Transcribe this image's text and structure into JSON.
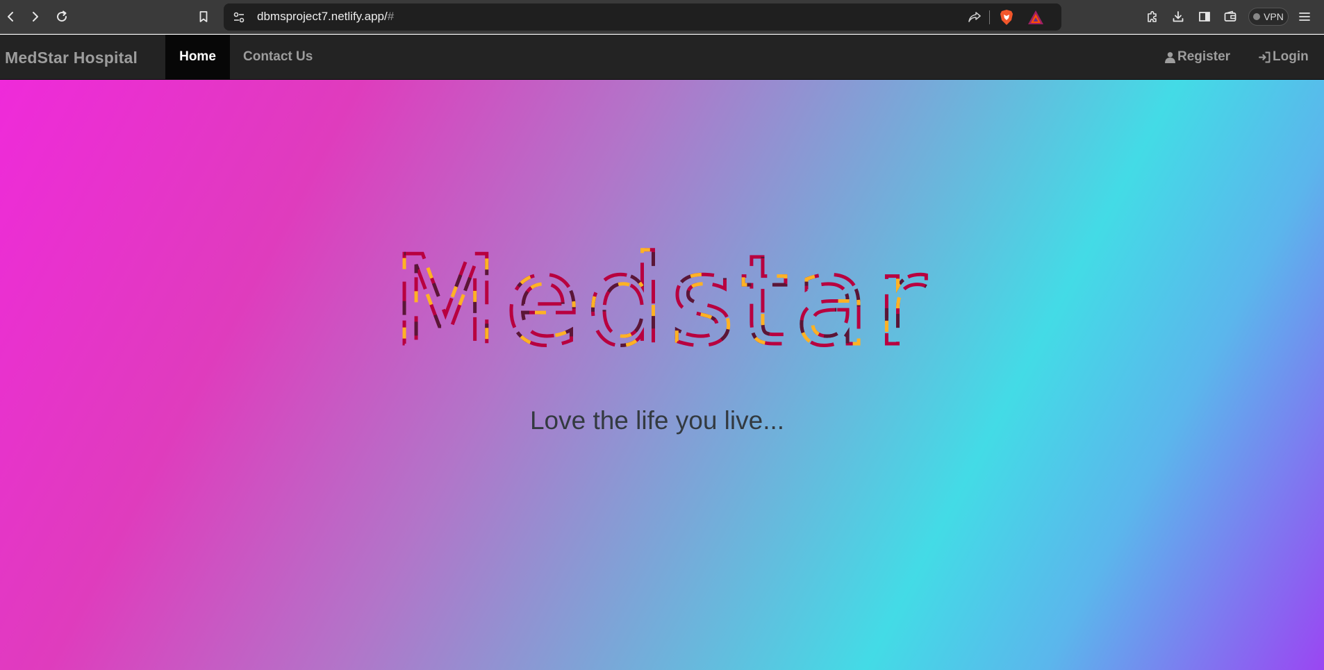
{
  "browser": {
    "url": "dbmsproject7.netlify.app/",
    "url_hash": "#",
    "vpn_label": "VPN",
    "icons": [
      "back-icon",
      "forward-icon",
      "reload-icon",
      "bookmark-icon",
      "site-settings-icon",
      "share-icon",
      "brave-shields-icon",
      "brave-rewards-icon",
      "extensions-icon",
      "downloads-icon",
      "sidebar-icon",
      "wallet-icon",
      "menu-icon"
    ]
  },
  "navbar": {
    "brand": "MedStar Hospital",
    "links": {
      "home": "Home",
      "contact": "Contact Us",
      "register": "Register",
      "login": "Login"
    },
    "icons": [
      "user-icon",
      "login-icon"
    ]
  },
  "hero": {
    "title": "Medstar",
    "tagline": "Love the life you live...",
    "gradient_colors": [
      "#ef2ada",
      "#df3cbd",
      "#b275c9",
      "#7aa7d8",
      "#43dbe6",
      "#7e79f0",
      "#9a46f2"
    ],
    "title_stroke_colors": [
      "#b8003f",
      "#5a1637",
      "#ffb224"
    ]
  }
}
